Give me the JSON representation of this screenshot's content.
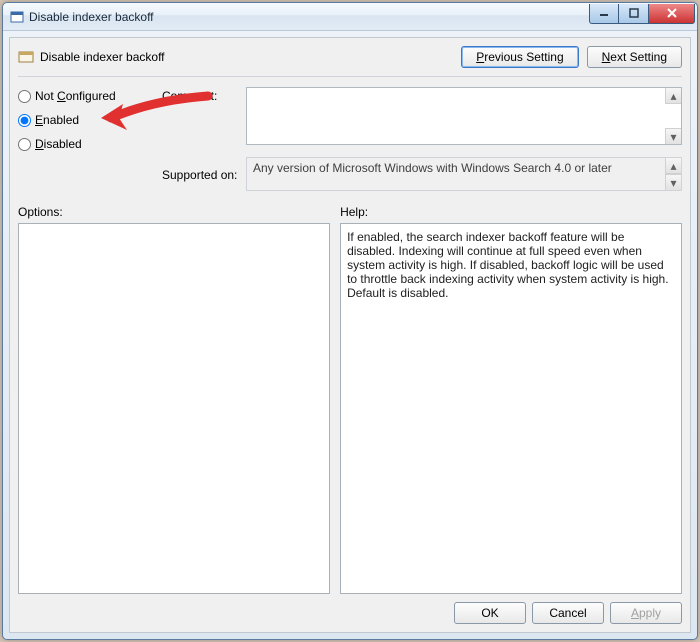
{
  "window": {
    "title": "Disable indexer backoff"
  },
  "header": {
    "title": "Disable indexer backoff",
    "prev_button": "Previous Setting",
    "next_button": "Next Setting"
  },
  "radios": {
    "not_configured": "Not Configured",
    "enabled": "Enabled",
    "disabled": "Disabled",
    "selected": "enabled"
  },
  "labels": {
    "comment": "Comment:",
    "supported_on": "Supported on:",
    "options": "Options:",
    "help": "Help:"
  },
  "fields": {
    "comment": "",
    "supported_on": "Any version of Microsoft Windows with Windows Search 4.0 or later",
    "options": "",
    "help": "If enabled, the search indexer backoff feature will be disabled. Indexing will continue at full speed even when system activity is high. If disabled, backoff logic will be used to throttle back indexing activity when system activity is high. Default is disabled."
  },
  "buttons": {
    "ok": "OK",
    "cancel": "Cancel",
    "apply": "Apply"
  }
}
